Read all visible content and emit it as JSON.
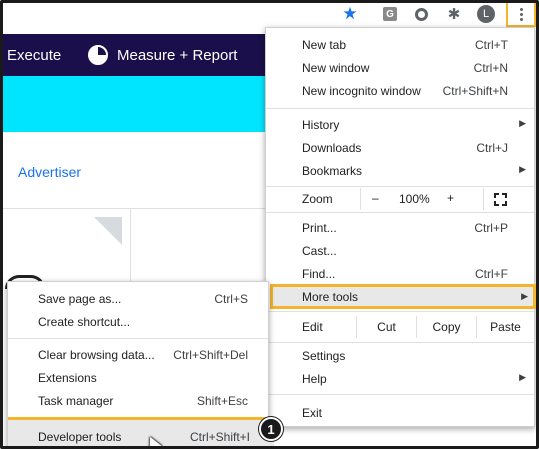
{
  "toolbar": {
    "icons": [
      "star-icon",
      "g-extension-icon",
      "circle-extension-icon",
      "puzzle-icon"
    ],
    "ext_g_label": "G",
    "avatar_letter": "L",
    "accent": "#1a73e8",
    "highlight": "#f4b52c"
  },
  "page": {
    "nav_execute": "Execute",
    "nav_measure": "Measure + Report",
    "advertiser": "Advertiser",
    "nav_bg": "#1a0f4a",
    "banner_bg": "#00e5ff"
  },
  "menu": {
    "new_tab": {
      "label": "New tab",
      "shortcut": "Ctrl+T"
    },
    "new_window": {
      "label": "New window",
      "shortcut": "Ctrl+N"
    },
    "new_incognito": {
      "label": "New incognito window",
      "shortcut": "Ctrl+Shift+N"
    },
    "history": {
      "label": "History"
    },
    "downloads": {
      "label": "Downloads",
      "shortcut": "Ctrl+J"
    },
    "bookmarks": {
      "label": "Bookmarks"
    },
    "zoom": {
      "label": "Zoom",
      "minus": "–",
      "value": "100%",
      "plus": "+"
    },
    "print": {
      "label": "Print...",
      "shortcut": "Ctrl+P"
    },
    "cast": {
      "label": "Cast..."
    },
    "find": {
      "label": "Find...",
      "shortcut": "Ctrl+F"
    },
    "more_tools": {
      "label": "More tools"
    },
    "edit": {
      "label": "Edit",
      "cut": "Cut",
      "copy": "Copy",
      "paste": "Paste"
    },
    "settings": {
      "label": "Settings"
    },
    "help": {
      "label": "Help"
    },
    "exit": {
      "label": "Exit"
    }
  },
  "submenu": {
    "save_page": {
      "label": "Save page as...",
      "shortcut": "Ctrl+S"
    },
    "create_shortcut": {
      "label": "Create shortcut..."
    },
    "clear_data": {
      "label": "Clear browsing data...",
      "shortcut": "Ctrl+Shift+Del"
    },
    "extensions": {
      "label": "Extensions"
    },
    "task_manager": {
      "label": "Task manager",
      "shortcut": "Shift+Esc"
    },
    "developer_tools": {
      "label": "Developer tools",
      "shortcut": "Ctrl+Shift+I"
    }
  },
  "step_badge": "1"
}
